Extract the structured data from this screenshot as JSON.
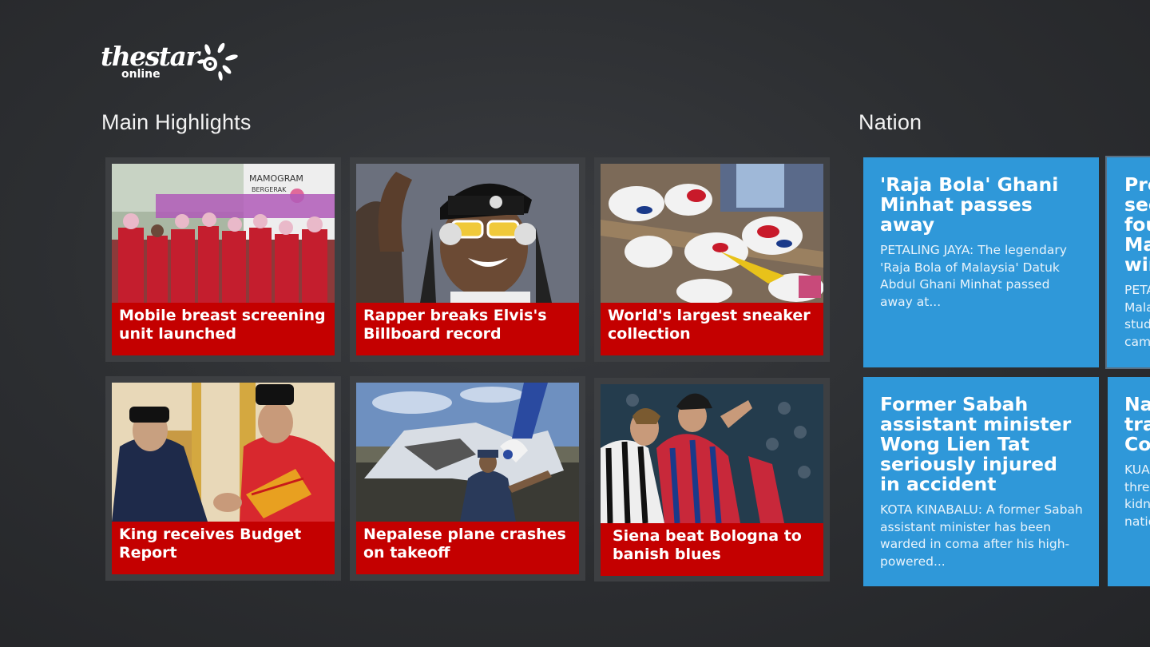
{
  "app": {
    "logo_text": "thestar",
    "logo_sub": "online"
  },
  "sections": {
    "main_highlights": "Main Highlights",
    "nation": "Nation"
  },
  "highlights": [
    {
      "caption": "Mobile breast screening unit launched",
      "photo_sign": "MAMOGRAM",
      "photo_sign2": "BERGERAK"
    },
    {
      "caption": "Rapper breaks Elvis's Billboard record"
    },
    {
      "caption": "World's largest sneaker collection"
    },
    {
      "caption": "King receives Budget Report"
    },
    {
      "caption": "Nepalese plane crashes on takeoff"
    },
    {
      "caption": "Siena beat Bologna to banish blues"
    }
  ],
  "nation": [
    {
      "title": "'Raja Bola' Ghani Minhat passes away",
      "body": "PETALING JAYA: The legendary 'Raja Bola of Malaysia' Datuk Abdul Ghani Minhat passed away at..."
    },
    {
      "title": "Pro see fou Ma win",
      "body": "PETA Mala stud cam"
    },
    {
      "title": "Former Sabah assistant minister Wong Lien Tat seriously injured in accident",
      "body": "KOTA KINABALU: A former Sabah assistant minister has been warded in coma after his high-powered..."
    },
    {
      "title": "Na tra Co",
      "body": "KUA thre kidn natio"
    }
  ],
  "colors": {
    "caption_red": "#c40000",
    "tile_blue": "#2f98d9",
    "background": "#2c2e31"
  }
}
